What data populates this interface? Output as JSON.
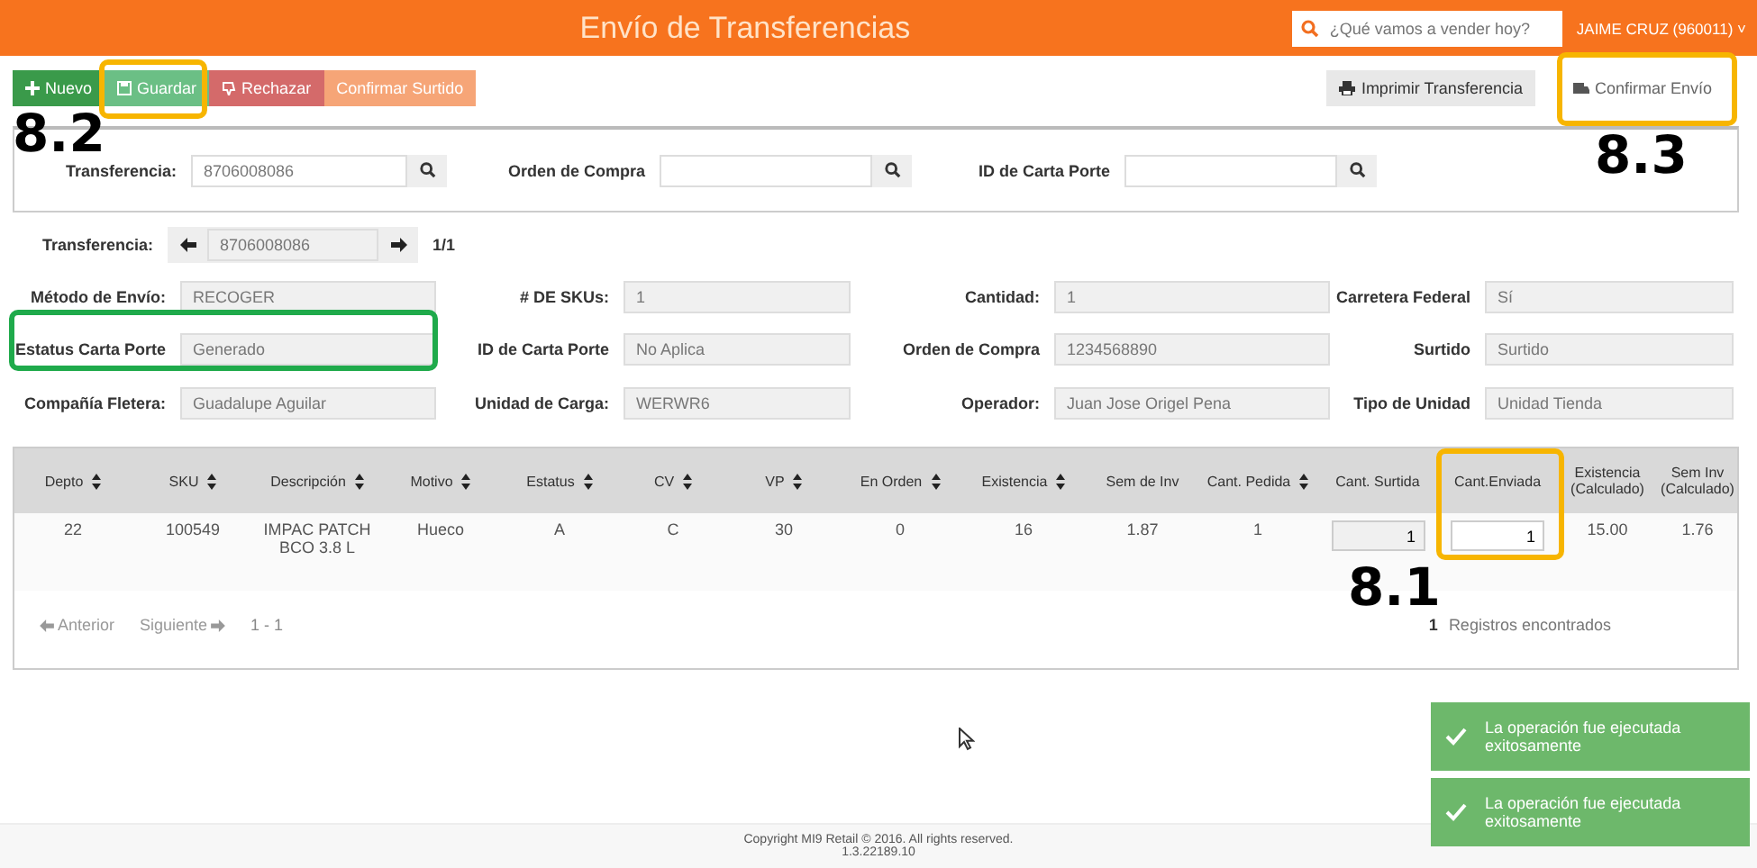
{
  "header": {
    "title": "Envío de Transferencias",
    "search_placeholder": "¿Qué vamos a vender hoy?",
    "user": "JAIME CRUZ (960011) ˅"
  },
  "toolbar": {
    "buttons": [
      {
        "label": "Nuevo",
        "kind": "new"
      },
      {
        "label": "Guardar",
        "kind": "save"
      },
      {
        "label": "Rechazar",
        "kind": "reject"
      },
      {
        "label": "Confirmar Surtido",
        "kind": "confirm"
      }
    ],
    "right_buttons": [
      {
        "label": "Imprimir Transferencia",
        "kind": "print"
      },
      {
        "label": "Confirmar Envío",
        "kind": "truck"
      }
    ]
  },
  "search_panel": [
    {
      "label": "Transferencia:",
      "value": "8706008086"
    },
    {
      "label": "Orden de Compra"
    },
    {
      "label": "ID de Carta Porte"
    }
  ],
  "transfer_nav": {
    "label": "Transferencia:",
    "value": "8706008086",
    "counter": "1/1"
  },
  "details": [
    {
      "label": "Método de Envío:",
      "value": "RECOGER"
    },
    {
      "label": "# DE SKUs:",
      "value": "1"
    },
    {
      "label": "Cantidad:",
      "value": "1"
    },
    {
      "label": "Carretera Federal",
      "value": "Sí"
    },
    {
      "label": "Estatus Carta Porte",
      "value": "Generado"
    },
    {
      "label": "ID de Carta Porte",
      "value": "No Aplica"
    },
    {
      "label": "Orden de Compra",
      "value": "1234568890"
    },
    {
      "label": "Surtido",
      "value": "Surtido"
    },
    {
      "label": "Compañía Fletera:",
      "value": "Guadalupe Aguilar"
    },
    {
      "label": "Unidad de Carga:",
      "value": "WERWR6"
    },
    {
      "label": "Operador:",
      "value": "Juan Jose Origel Pena"
    },
    {
      "label": "Tipo de Unidad",
      "value": "Unidad Tienda"
    }
  ],
  "table": {
    "columns": [
      {
        "label": "Depto",
        "sortable": true
      },
      {
        "label": "SKU",
        "sortable": true
      },
      {
        "label": "Descripción",
        "sortable": true
      },
      {
        "label": "Motivo",
        "sortable": true
      },
      {
        "label": "Estatus",
        "sortable": true
      },
      {
        "label": "CV",
        "sortable": true
      },
      {
        "label": "VP",
        "sortable": true
      },
      {
        "label": "En Orden",
        "sortable": true
      },
      {
        "label": "Existencia",
        "sortable": true
      },
      {
        "label": "Sem de Inv",
        "sortable": false
      },
      {
        "label": "Cant. Pedida",
        "sortable": true
      },
      {
        "label": "Cant. Surtida",
        "sortable": false
      },
      {
        "label": "Cant.Enviada",
        "sortable": false
      },
      {
        "label": "Existencia (Calculado)",
        "sortable": false
      },
      {
        "label": "Sem Inv (Calculado)",
        "sortable": false
      }
    ],
    "rows": [
      [
        {
          "text": "22"
        },
        {
          "text": "100549"
        },
        {
          "text": "IMPAC PATCH BCO 3.8 L"
        },
        {
          "text": "Hueco"
        },
        {
          "text": "A"
        },
        {
          "text": "C"
        },
        {
          "text": "30"
        },
        {
          "text": "0"
        },
        {
          "text": "16"
        },
        {
          "text": "1.87"
        },
        {
          "text": "1"
        },
        {
          "text": "1",
          "kind": "readonly-input"
        },
        {
          "text": "1",
          "kind": "input"
        },
        {
          "text": "15.00"
        },
        {
          "text": "1.76"
        }
      ]
    ]
  },
  "pager": {
    "previous": "Anterior",
    "next": "Siguiente",
    "range": "1 - 1",
    "count": "1",
    "count_label": "Registros encontrados"
  },
  "toasts": [
    "La operación fue ejecutada exitosamente",
    "La operación fue ejecutada exitosamente"
  ],
  "annotations": [
    {
      "kind": "frame",
      "color": "#f7b500"
    },
    {
      "kind": "frame",
      "color": "#f7b500"
    },
    {
      "kind": "frame",
      "color": "#f7b500"
    },
    {
      "kind": "frame",
      "color": "#1faa4b"
    },
    {
      "kind": "callout",
      "label": "8.2"
    },
    {
      "kind": "callout",
      "label": "8.3"
    },
    {
      "kind": "callout",
      "label": "8.1"
    }
  ],
  "footer": {
    "copyright": "Copyright MI9 Retail © 2016. All rights reserved.",
    "version": "1.3.22189.10"
  }
}
